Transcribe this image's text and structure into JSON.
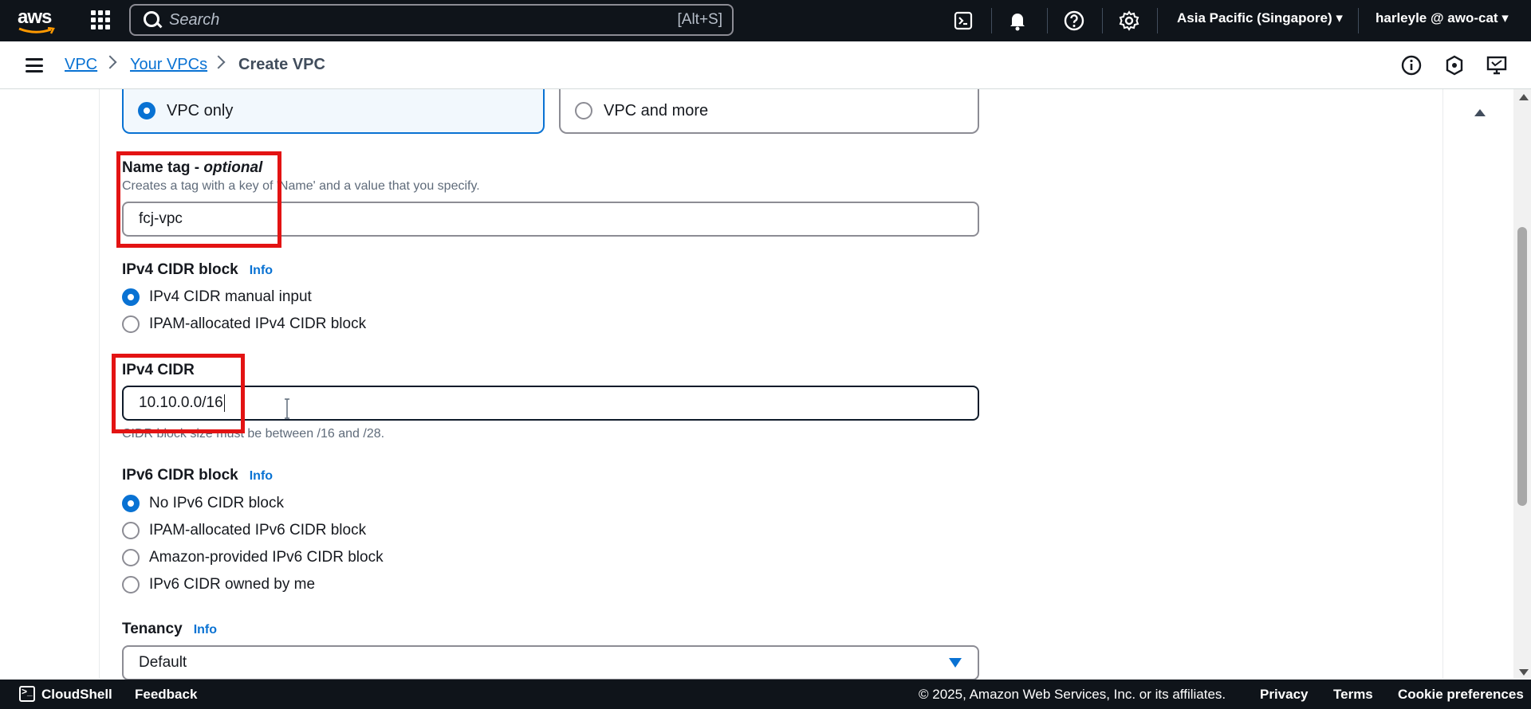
{
  "topbar": {
    "logo_text": "aws",
    "search_placeholder": "Search",
    "search_shortcut": "[Alt+S]",
    "region": "Asia Pacific (Singapore) ▾",
    "user": "harleyle @ awo-cat ▾"
  },
  "breadcrumb": {
    "items": [
      "VPC",
      "Your VPCs"
    ],
    "current": "Create VPC"
  },
  "resources": {
    "option_vpc_only": "VPC only",
    "option_vpc_and_more": "VPC and more"
  },
  "name_tag": {
    "label": "Name tag - ",
    "label_optional": "optional",
    "description": "Creates a tag with a key of 'Name' and a value that you specify.",
    "value": "fcj-vpc"
  },
  "ipv4_block": {
    "label": "IPv4 CIDR block",
    "info": "Info",
    "options": [
      "IPv4 CIDR manual input",
      "IPAM-allocated IPv4 CIDR block"
    ],
    "selected": 0
  },
  "ipv4_cidr": {
    "label": "IPv4 CIDR",
    "value": "10.10.0.0/16",
    "constraint": "CIDR block size must be between /16 and /28."
  },
  "ipv6_block": {
    "label": "IPv6 CIDR block",
    "info": "Info",
    "options": [
      "No IPv6 CIDR block",
      "IPAM-allocated IPv6 CIDR block",
      "Amazon-provided IPv6 CIDR block",
      "IPv6 CIDR owned by me"
    ],
    "selected": 0
  },
  "tenancy": {
    "label": "Tenancy",
    "info": "Info",
    "value": "Default"
  },
  "footer": {
    "cloudshell": "CloudShell",
    "feedback": "Feedback",
    "copyright": "© 2025, Amazon Web Services, Inc. or its affiliates.",
    "privacy": "Privacy",
    "terms": "Terms",
    "cookies": "Cookie preferences"
  },
  "colors": {
    "accent": "#0972d3",
    "highlight": "#e31313",
    "topbar": "#0f141a"
  }
}
